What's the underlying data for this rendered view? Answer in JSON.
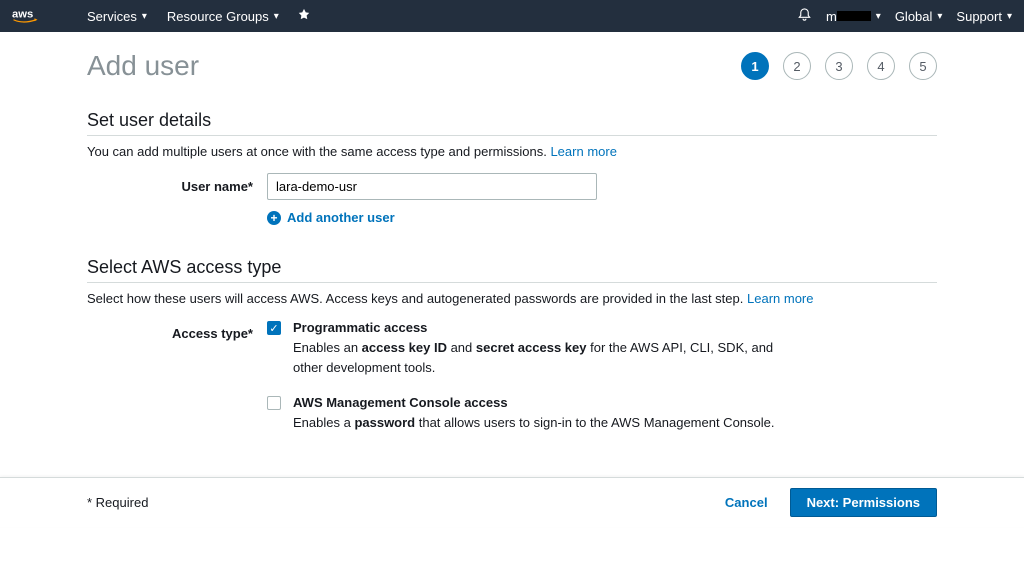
{
  "topnav": {
    "services": "Services",
    "resource_groups": "Resource Groups",
    "account_prefix": "m",
    "region": "Global",
    "support": "Support"
  },
  "page": {
    "title": "Add user"
  },
  "stepper": {
    "steps": [
      "1",
      "2",
      "3",
      "4",
      "5"
    ],
    "active_index": 0
  },
  "user_details": {
    "title": "Set user details",
    "desc": "You can add multiple users at once with the same access type and permissions.",
    "learn_more": "Learn more",
    "username_label": "User name*",
    "username_value": "lara-demo-usr",
    "add_another": "Add another user"
  },
  "access_type": {
    "title": "Select AWS access type",
    "desc": "Select how these users will access AWS. Access keys and autogenerated passwords are provided in the last step.",
    "learn_more": "Learn more",
    "label": "Access type*",
    "programmatic": {
      "checked": true,
      "title": "Programmatic access",
      "desc_pre": "Enables an ",
      "k1": "access key ID",
      "mid": " and ",
      "k2": "secret access key",
      "desc_post": " for the AWS API, CLI, SDK, and other development tools."
    },
    "console": {
      "checked": false,
      "title": "AWS Management Console access",
      "desc_pre": "Enables a ",
      "k1": "password",
      "desc_post": " that allows users to sign-in to the AWS Management Console."
    }
  },
  "footer": {
    "required": "* Required",
    "cancel": "Cancel",
    "next": "Next: Permissions"
  }
}
